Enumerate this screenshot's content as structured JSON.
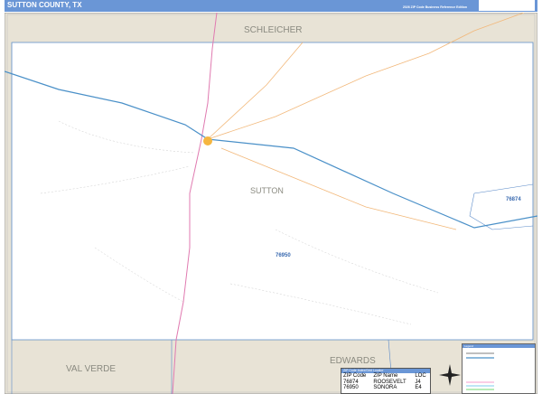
{
  "header": {
    "title": "SUTTON COUNTY, TX",
    "edition": "2026 ZIP Code Business Reference Edition"
  },
  "map": {
    "county_label": "SUTTON",
    "neighbors": [
      "SCHLEICHER",
      "EDWARDS",
      "VAL VERDE"
    ],
    "zip_labels": [
      "76874",
      "76950"
    ],
    "colors": {
      "frame": "#6a96d6",
      "neighbor_fill": "#e8e3d6",
      "highway": "#4a90c8",
      "route": "#f2b87a",
      "us_route": "#e07ab0"
    }
  },
  "index": {
    "title": "ZIP Code Index/Grid Locator",
    "columns": [
      "ZIP Code",
      "ZIP Name",
      "LOC"
    ],
    "rows": [
      [
        "76874",
        "ROOSEVELT",
        "J4"
      ],
      [
        "76950",
        "SONORA",
        "E4"
      ]
    ]
  },
  "legend": {
    "title": "Legend"
  }
}
